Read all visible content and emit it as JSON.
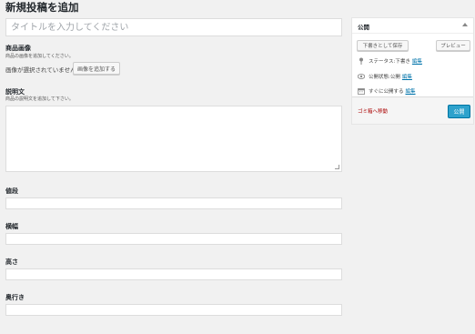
{
  "page": {
    "title": "新規投稿を追加"
  },
  "title_field": {
    "placeholder": "タイトルを入力してください"
  },
  "product_image": {
    "label": "商品画像",
    "description": "商品の画像を追加してください。",
    "status": "画像が選択されていません",
    "add_button": "画像を追加する"
  },
  "description": {
    "label": "説明文",
    "hint": "商品の説明文を追加して下さい。"
  },
  "fields": [
    {
      "label": "値段",
      "value": ""
    },
    {
      "label": "横幅",
      "value": ""
    },
    {
      "label": "高さ",
      "value": ""
    },
    {
      "label": "奥行き",
      "value": ""
    }
  ],
  "publish": {
    "title": "公開",
    "save_draft": "下書きとして保存",
    "preview": "プレビュー",
    "status_label": "ステータス:",
    "status_value": "下書き",
    "visibility_label": "公開状態:",
    "visibility_value": "公開",
    "schedule_label": "すぐに公開する",
    "edit": "編集",
    "trash": "ゴミ箱へ移動",
    "publish_button": "公開"
  }
}
